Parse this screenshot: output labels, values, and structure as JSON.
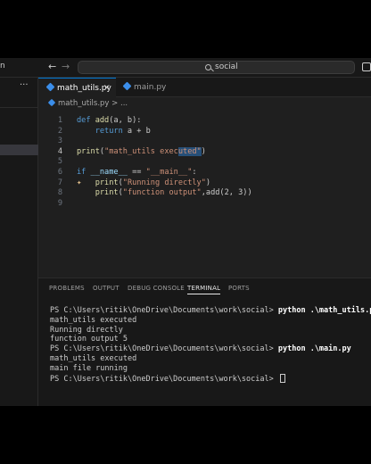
{
  "titlebar": {
    "menu_fragment": "n",
    "search_text": "social"
  },
  "sidebar": {
    "more_label": "···"
  },
  "tabs": [
    {
      "label": "math_utils.py",
      "active": true
    },
    {
      "label": "main.py",
      "active": false
    }
  ],
  "breadcrumb": {
    "file": "math_utils.py",
    "rest": "> ..."
  },
  "editor": {
    "lines": [
      {
        "num": "1",
        "segments": [
          [
            "kw",
            "def "
          ],
          [
            "fn",
            "add"
          ],
          [
            "plain",
            "(a, b):"
          ]
        ]
      },
      {
        "num": "2",
        "segments": [
          [
            "plain",
            "    "
          ],
          [
            "kw",
            "return"
          ],
          [
            "plain",
            " a + b"
          ]
        ]
      },
      {
        "num": "3",
        "segments": []
      },
      {
        "num": "4",
        "segments": [
          [
            "fn",
            "print"
          ],
          [
            "plain",
            "("
          ],
          [
            "str",
            "\"math_utils exec"
          ],
          [
            "sel",
            "uted\""
          ],
          [
            "plain",
            ")"
          ]
        ]
      },
      {
        "num": "5",
        "segments": []
      },
      {
        "num": "6",
        "segments": [
          [
            "kw",
            "if "
          ],
          [
            "dunder",
            "__name__"
          ],
          [
            "plain",
            " == "
          ],
          [
            "str",
            "\"__main__\""
          ],
          [
            "plain",
            ":"
          ]
        ]
      },
      {
        "num": "7",
        "segments": [
          [
            "plain",
            "    "
          ],
          [
            "fn",
            "print"
          ],
          [
            "plain",
            "("
          ],
          [
            "str",
            "\"Running directly\""
          ],
          [
            "plain",
            ")"
          ]
        ]
      },
      {
        "num": "8",
        "segments": [
          [
            "plain",
            "    "
          ],
          [
            "fn",
            "print"
          ],
          [
            "plain",
            "("
          ],
          [
            "str",
            "\"function output\""
          ],
          [
            "plain",
            ",add(2, 3))"
          ]
        ]
      },
      {
        "num": "9",
        "segments": []
      }
    ]
  },
  "panel": {
    "tabs": [
      "PROBLEMS",
      "OUTPUT",
      "DEBUG CONSOLE",
      "TERMINAL",
      "PORTS"
    ],
    "active_tab": "TERMINAL"
  },
  "terminal": {
    "lines": [
      {
        "prompt": "PS C:\\Users\\ritik\\OneDrive\\Documents\\work\\social> ",
        "cmd": "python .\\math_utils.py"
      },
      {
        "text": "math_utils executed"
      },
      {
        "text": "Running directly"
      },
      {
        "text": "function output 5"
      },
      {
        "prompt": "PS C:\\Users\\ritik\\OneDrive\\Documents\\work\\social> ",
        "cmd": "python .\\main.py"
      },
      {
        "text": "math_utils executed"
      },
      {
        "text": "main file running"
      },
      {
        "prompt": "PS C:\\Users\\ritik\\OneDrive\\Documents\\work\\social> ",
        "cursor": true
      }
    ]
  },
  "colors": {
    "editor_bg": "#1f1f1f",
    "panel_bg": "#181818",
    "accent": "#0078d4",
    "keyword": "#569cd6",
    "function": "#dcdcaa",
    "string": "#ce9178"
  }
}
